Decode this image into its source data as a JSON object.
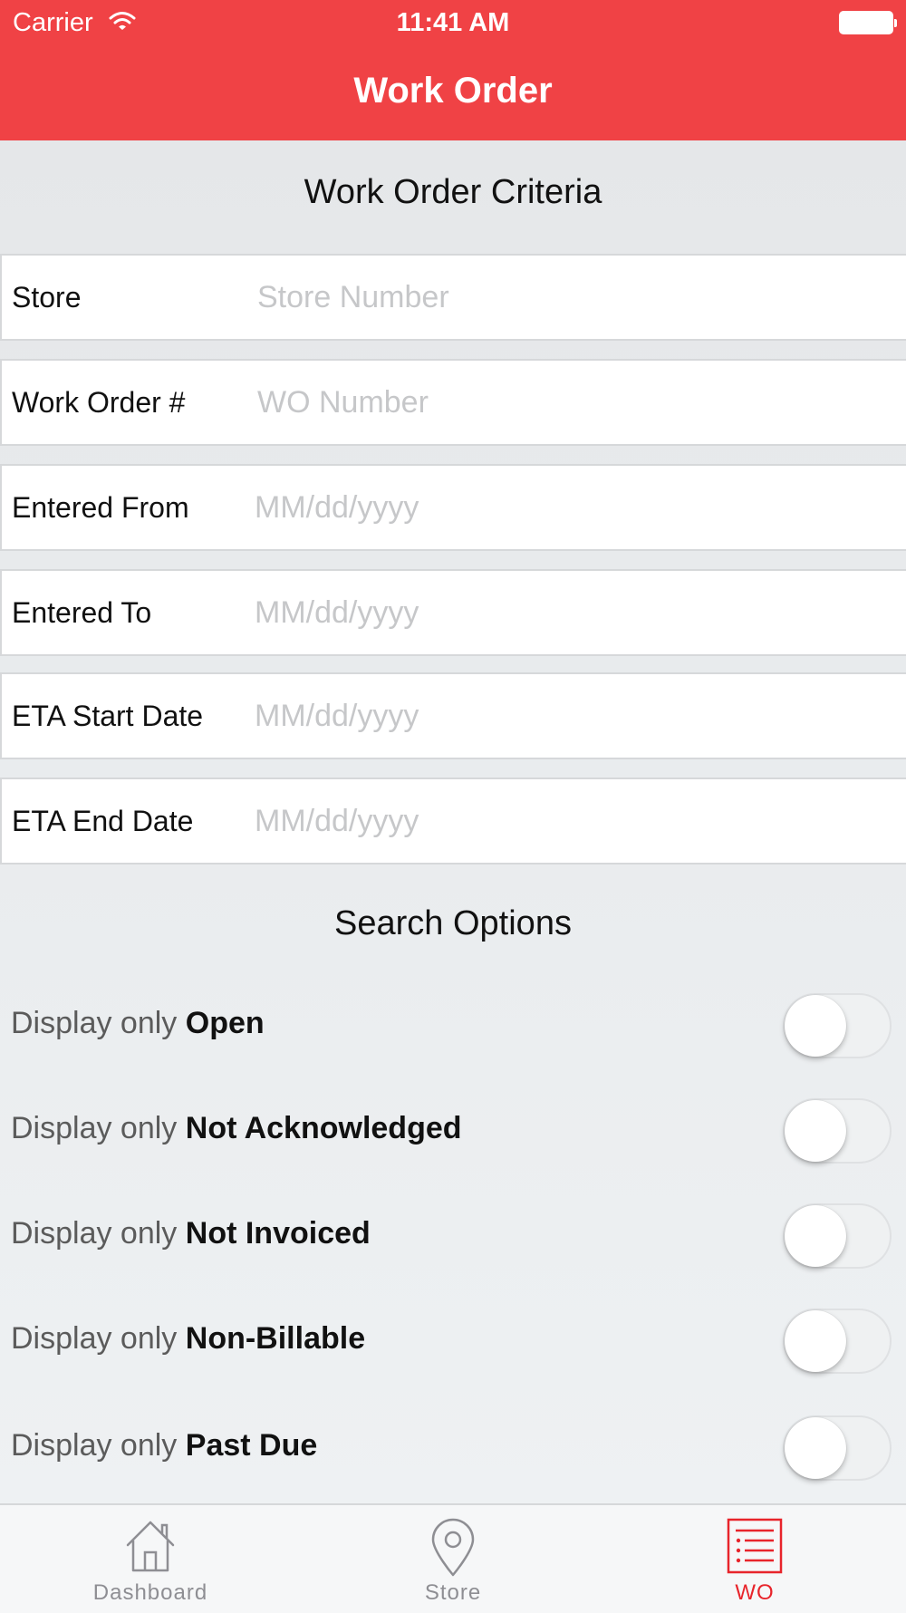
{
  "status_bar": {
    "carrier": "Carrier",
    "time": "11:41 AM"
  },
  "header": {
    "title": "Work Order"
  },
  "criteria": {
    "title": "Work Order Criteria",
    "fields": [
      {
        "label": "Store",
        "placeholder": "Store Number",
        "value": ""
      },
      {
        "label": "Work Order #",
        "placeholder": "WO Number",
        "value": ""
      },
      {
        "label": "Entered From",
        "placeholder": "MM/dd/yyyy",
        "value": ""
      },
      {
        "label": "Entered To",
        "placeholder": "MM/dd/yyyy",
        "value": ""
      },
      {
        "label": "ETA Start Date",
        "placeholder": "MM/dd/yyyy",
        "value": ""
      },
      {
        "label": "ETA End Date",
        "placeholder": "MM/dd/yyyy",
        "value": ""
      }
    ]
  },
  "options": {
    "title": "Search Options",
    "items": [
      {
        "prefix": "Display only",
        "strong": "Open",
        "on": false
      },
      {
        "prefix": "Display only",
        "strong": "Not Acknowledged",
        "on": false
      },
      {
        "prefix": "Display only",
        "strong": "Not Invoiced",
        "on": false
      },
      {
        "prefix": "Display only",
        "strong": "Non-Billable",
        "on": false
      },
      {
        "prefix": "Display only",
        "strong": "Past Due",
        "on": false
      }
    ]
  },
  "tab_bar": {
    "active_index": 2,
    "tabs": [
      {
        "label": "Dashboard",
        "icon": "house-icon"
      },
      {
        "label": "Store",
        "icon": "location-pin-icon"
      },
      {
        "label": "WO",
        "icon": "list-icon"
      }
    ]
  },
  "colors": {
    "brand": "#f04245",
    "active_tab": "#e8242b",
    "inactive_tab": "#8e8e93"
  }
}
